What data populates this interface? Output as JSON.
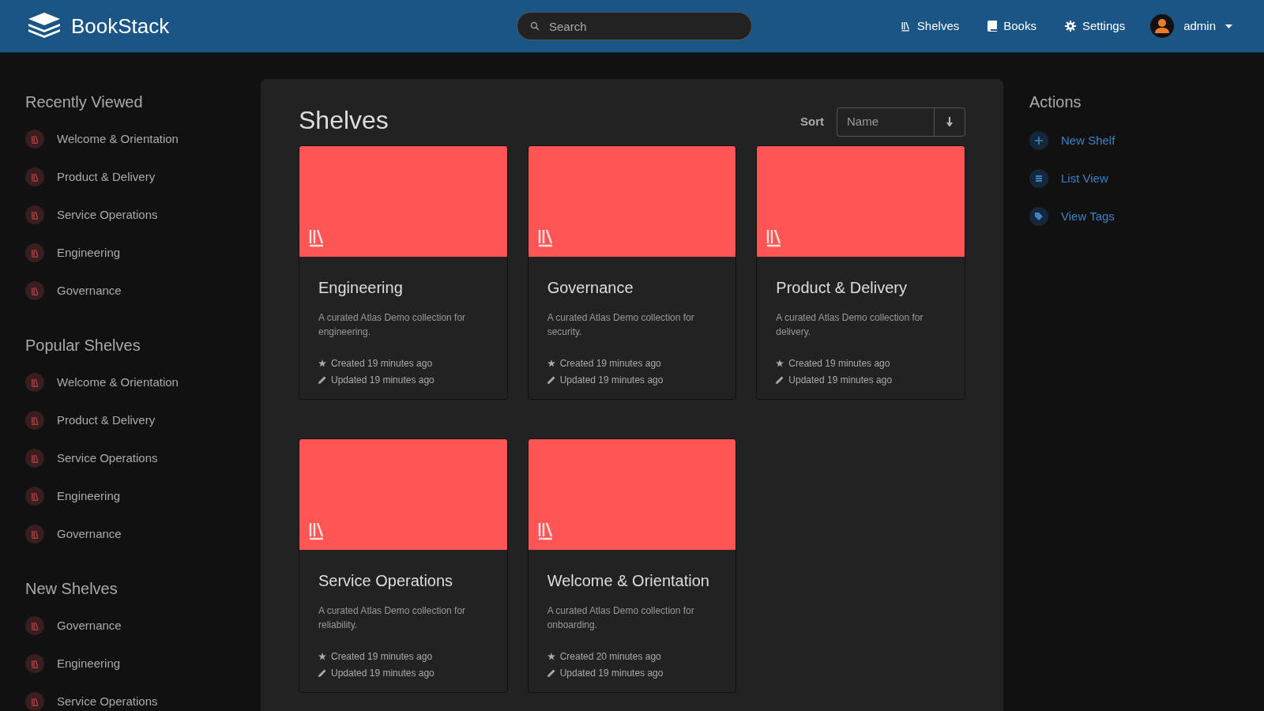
{
  "header": {
    "app_name": "BookStack",
    "search": {
      "placeholder": "Search"
    },
    "nav": [
      {
        "kind": "shelves",
        "label": "Shelves"
      },
      {
        "kind": "books",
        "label": "Books"
      },
      {
        "kind": "settings",
        "label": "Settings"
      }
    ],
    "user": {
      "name": "admin"
    }
  },
  "sidebar": [
    {
      "title": "Recently Viewed",
      "items": [
        "Welcome & Orientation",
        "Product & Delivery",
        "Service Operations",
        "Engineering",
        "Governance"
      ]
    },
    {
      "title": "Popular Shelves",
      "items": [
        "Welcome & Orientation",
        "Product & Delivery",
        "Service Operations",
        "Engineering",
        "Governance"
      ]
    },
    {
      "title": "New Shelves",
      "items": [
        "Governance",
        "Engineering",
        "Service Operations"
      ]
    }
  ],
  "main": {
    "title": "Shelves",
    "sort": {
      "label": "Sort",
      "value": "Name"
    },
    "shelves": [
      {
        "name": "Engineering",
        "description": "A curated Atlas Demo collection for engineering.",
        "created": "Created 19 minutes ago",
        "updated": "Updated 19 minutes ago"
      },
      {
        "name": "Governance",
        "description": "A curated Atlas Demo collection for security.",
        "created": "Created 19 minutes ago",
        "updated": "Updated 19 minutes ago"
      },
      {
        "name": "Product & Delivery",
        "description": "A curated Atlas Demo collection for delivery.",
        "created": "Created 19 minutes ago",
        "updated": "Updated 19 minutes ago"
      },
      {
        "name": "Service Operations",
        "description": "A curated Atlas Demo collection for reliability.",
        "created": "Created 19 minutes ago",
        "updated": "Updated 19 minutes ago"
      },
      {
        "name": "Welcome & Orientation",
        "description": "A curated Atlas Demo collection for onboarding.",
        "created": "Created 20 minutes ago",
        "updated": "Updated 19 minutes ago"
      }
    ]
  },
  "actions": {
    "title": "Actions",
    "items": [
      {
        "kind": "add",
        "label": "New Shelf"
      },
      {
        "kind": "list",
        "label": "List View"
      },
      {
        "kind": "tag",
        "label": "View Tags"
      }
    ]
  }
}
